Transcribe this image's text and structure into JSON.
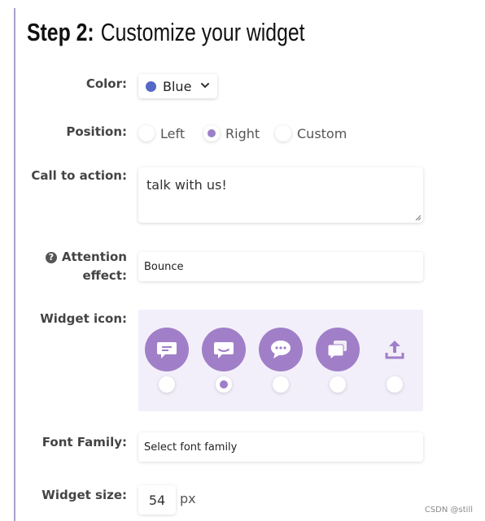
{
  "header": {
    "step": "Step 2:",
    "title": "Customize your widget"
  },
  "labels": {
    "color": "Color:",
    "position": "Position:",
    "call_to_action": "Call to action:",
    "attention_1": "Attention",
    "attention_2": "effect:",
    "widget_icon": "Widget icon:",
    "font_family": "Font Family:",
    "widget_size": "Widget size:"
  },
  "color": {
    "selected": "Blue",
    "swatch": "#5468c8"
  },
  "position": {
    "options": [
      "Left",
      "Right",
      "Custom"
    ],
    "selected": "Right"
  },
  "call_to_action": {
    "value": "talk with us!"
  },
  "attention_effect": {
    "value": "Bounce"
  },
  "widget_icons": {
    "icons": [
      "chat-bubble-lines-icon",
      "chat-bubble-smile-icon",
      "chat-bubble-dots-icon",
      "chat-bubbles-stack-icon",
      "upload-icon"
    ],
    "selected_index": 1,
    "accent": "#a07fc8"
  },
  "font_family": {
    "value": "Select font family"
  },
  "widget_size": {
    "value": "54",
    "unit": "px"
  },
  "watermark": "CSDN @still"
}
